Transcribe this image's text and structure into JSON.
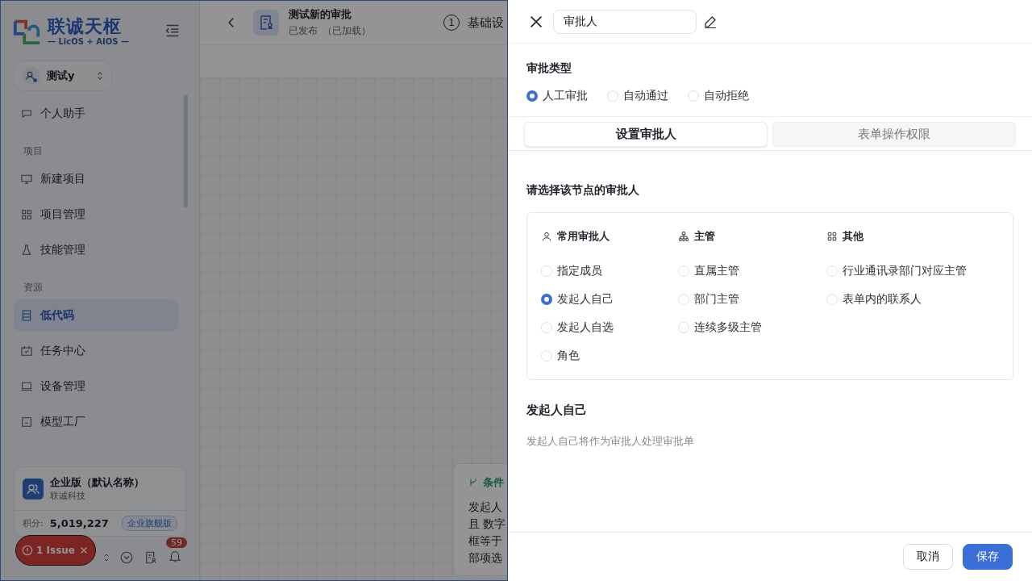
{
  "sidebar": {
    "logo": {
      "name": "联诚天枢",
      "tagline": "— LicOS + AIOS —"
    },
    "workspace": "测试y",
    "items": [
      {
        "kind": "item",
        "label": "个人助手",
        "selected": false
      },
      {
        "kind": "section",
        "label": "项目"
      },
      {
        "kind": "item",
        "label": "新建项目",
        "selected": false
      },
      {
        "kind": "item",
        "label": "项目管理",
        "selected": false
      },
      {
        "kind": "item",
        "label": "技能管理",
        "selected": false
      },
      {
        "kind": "section",
        "label": "资源"
      },
      {
        "kind": "item",
        "label": "低代码",
        "selected": true
      },
      {
        "kind": "item",
        "label": "任务中心",
        "selected": false
      },
      {
        "kind": "item",
        "label": "设备管理",
        "selected": false
      },
      {
        "kind": "item",
        "label": "模型工厂",
        "selected": false
      }
    ],
    "org": {
      "name": "企业版（默认名称）",
      "company": "联诚科技",
      "points_label": "积分:",
      "points": "5,019,227",
      "plan": "企业旗舰版"
    },
    "issue": "1 Issue",
    "notification_count": "59"
  },
  "header": {
    "title": "测试新的审批",
    "status": "已发布",
    "loaded": "（已加载）",
    "step_number": "1",
    "step_label": "基础设"
  },
  "canvas_card": {
    "title": "条件",
    "lines": [
      "发起人",
      "且 数字",
      "框等于",
      "部项选"
    ]
  },
  "drawer": {
    "name_value": "审批人",
    "type_title": "审批类型",
    "types": [
      {
        "label": "人工审批",
        "selected": true
      },
      {
        "label": "自动通过",
        "selected": false
      },
      {
        "label": "自动拒绝",
        "selected": false
      }
    ],
    "tabs": [
      {
        "label": "设置审批人",
        "selected": true
      },
      {
        "label": "表单操作权限",
        "selected": false
      }
    ],
    "section_title": "请选择该节点的审批人",
    "groups": [
      {
        "title": "常用审批人",
        "options": [
          {
            "label": "指定成员",
            "selected": false
          },
          {
            "label": "发起人自己",
            "selected": true
          },
          {
            "label": "发起人自选",
            "selected": false
          },
          {
            "label": "角色",
            "selected": false
          }
        ]
      },
      {
        "title": "主管",
        "options": [
          {
            "label": "直属主管",
            "selected": false
          },
          {
            "label": "部门主管",
            "selected": false
          },
          {
            "label": "连续多级主管",
            "selected": false
          }
        ]
      },
      {
        "title": "其他",
        "options": [
          {
            "label": "行业通讯录部门对应主管",
            "selected": false
          },
          {
            "label": "表单内的联系人",
            "selected": false
          }
        ]
      }
    ],
    "selected_title": "发起人自己",
    "selected_desc": "发起人自己将作为审批人处理审批单",
    "buttons": [
      {
        "label": "取消",
        "kind": "secondary"
      },
      {
        "label": "保存",
        "kind": "primary"
      }
    ]
  }
}
